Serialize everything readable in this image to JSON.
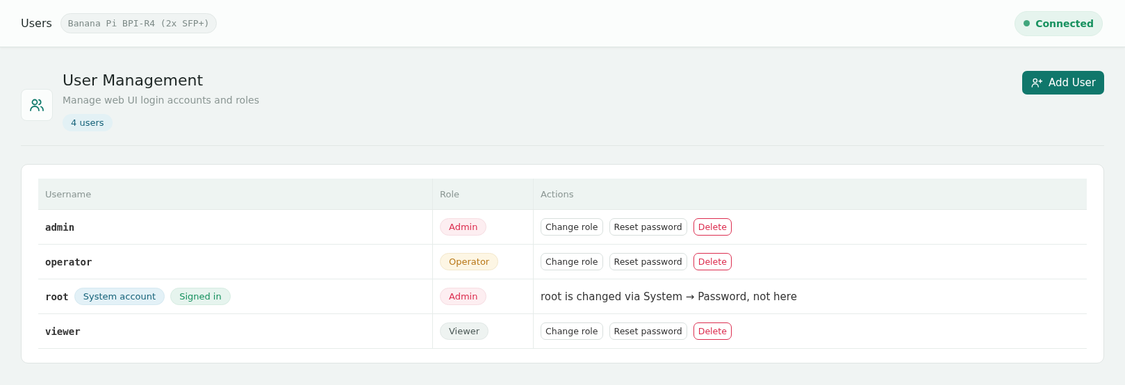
{
  "topbar": {
    "title": "Users",
    "device": "Banana Pi BPI-R4 (2x SFP+)",
    "status": {
      "label": "Connected",
      "connected": true
    }
  },
  "page": {
    "title": "User Management",
    "subtitle": "Manage web UI login accounts and roles",
    "count": "4 users",
    "add_button": "Add User"
  },
  "table": {
    "columns": [
      "Username",
      "Role",
      "Actions"
    ],
    "rows": [
      {
        "username": "admin",
        "tags": [],
        "role": {
          "label": "Admin",
          "kind": "admin"
        },
        "actions": [
          {
            "label": "Change role",
            "kind": "default"
          },
          {
            "label": "Reset password",
            "kind": "default"
          },
          {
            "label": "Delete",
            "kind": "danger"
          }
        ]
      },
      {
        "username": "operator",
        "tags": [],
        "role": {
          "label": "Operator",
          "kind": "operator"
        },
        "actions": [
          {
            "label": "Change role",
            "kind": "default"
          },
          {
            "label": "Reset password",
            "kind": "default"
          },
          {
            "label": "Delete",
            "kind": "danger"
          }
        ]
      },
      {
        "username": "root",
        "tags": [
          {
            "label": "System account",
            "kind": "system"
          },
          {
            "label": "Signed in",
            "kind": "session"
          }
        ],
        "role": {
          "label": "Admin",
          "kind": "admin"
        },
        "note": "root is changed via System → Password, not here"
      },
      {
        "username": "viewer",
        "tags": [],
        "role": {
          "label": "Viewer",
          "kind": "viewer"
        },
        "actions": [
          {
            "label": "Change role",
            "kind": "default"
          },
          {
            "label": "Reset password",
            "kind": "default"
          },
          {
            "label": "Delete",
            "kind": "danger"
          }
        ]
      }
    ]
  }
}
